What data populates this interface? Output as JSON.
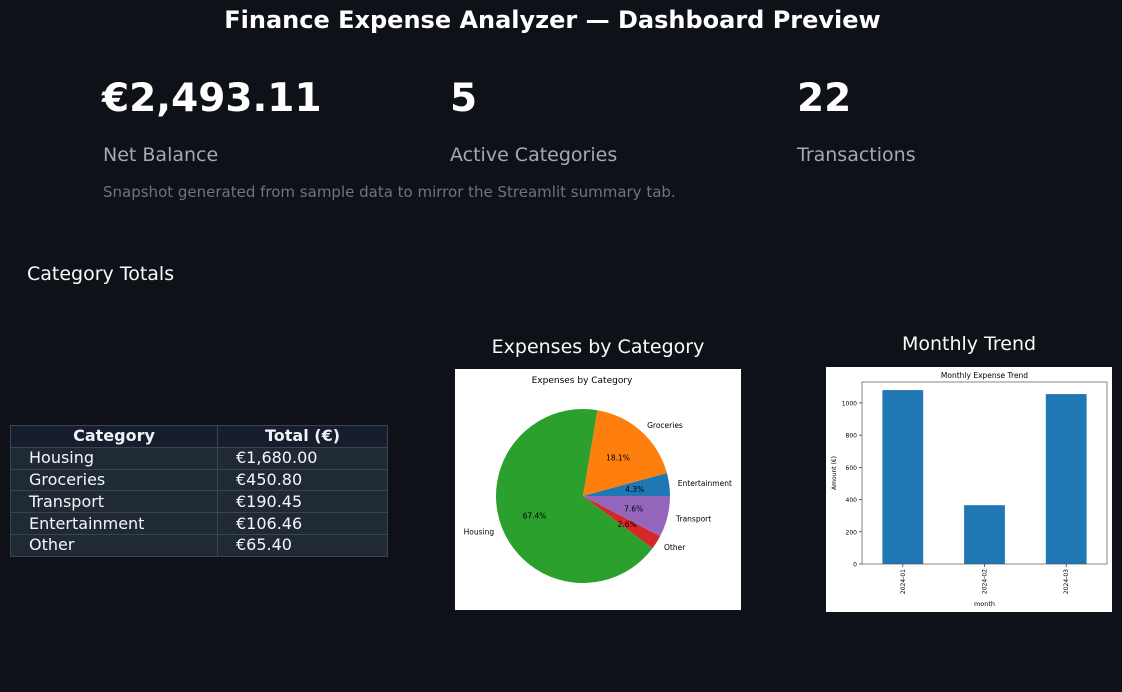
{
  "header": {
    "title": "Finance Expense Analyzer — Dashboard Preview"
  },
  "metrics": [
    {
      "value": "€2,493.11",
      "label": "Net Balance"
    },
    {
      "value": "5",
      "label": "Active Categories"
    },
    {
      "value": "22",
      "label": "Transactions"
    }
  ],
  "caption": "Snapshot generated from sample data to mirror the Streamlit summary tab.",
  "category_totals": {
    "heading": "Category Totals",
    "columns": [
      "Category",
      "Total (€)"
    ],
    "rows": [
      [
        "Housing",
        "€1,680.00"
      ],
      [
        "Groceries",
        "€450.80"
      ],
      [
        "Transport",
        "€190.45"
      ],
      [
        "Entertainment",
        "€106.46"
      ],
      [
        "Other",
        "€65.40"
      ]
    ]
  },
  "pie_panel": {
    "heading": "Expenses by Category"
  },
  "bar_panel": {
    "heading": "Monthly Trend"
  },
  "chart_data": [
    {
      "type": "pie",
      "title": "Expenses by Category",
      "labels": [
        "Entertainment",
        "Groceries",
        "Housing",
        "Other",
        "Transport"
      ],
      "values": [
        106.46,
        450.8,
        1680.0,
        65.4,
        190.45
      ],
      "percent_labels": [
        "4.3%",
        "18.1%",
        "67.4%",
        "2.6%",
        "7.6%"
      ],
      "colors": [
        "#1f77b4",
        "#ff7f0e",
        "#2ca02c",
        "#d62728",
        "#9467bd"
      ]
    },
    {
      "type": "bar",
      "title": "Monthly Expense Trend",
      "categories": [
        "2024-01",
        "2024-02",
        "2024-03"
      ],
      "values": [
        1080,
        365,
        1055
      ],
      "xlabel": "month",
      "ylabel": "Amount (€)",
      "ylim": [
        0,
        1130
      ],
      "yticks": [
        0,
        200,
        400,
        600,
        800,
        1000
      ],
      "color": "#1f77b4"
    }
  ]
}
